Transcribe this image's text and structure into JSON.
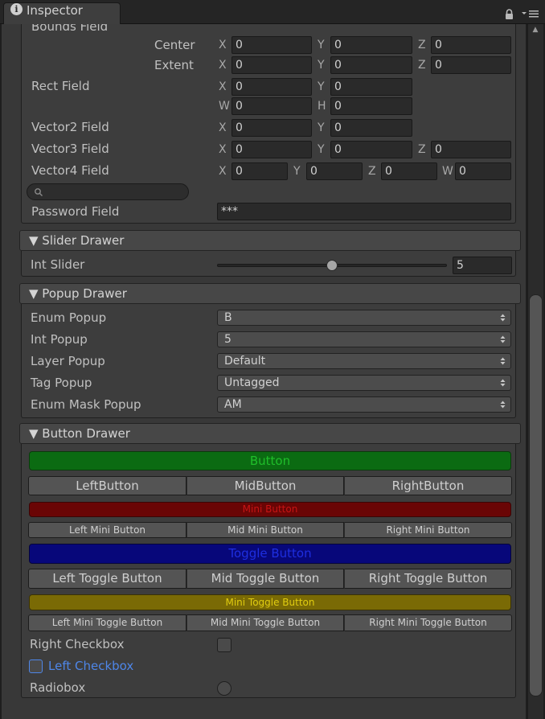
{
  "window": {
    "tab_title": "Inspector",
    "info_icon": "i"
  },
  "bounds": {
    "label": "Bounds Field",
    "center_label": "Center",
    "extent_label": "Extent",
    "center": {
      "x": "0",
      "y": "0",
      "z": "0"
    },
    "extent": {
      "x": "0",
      "y": "0",
      "z": "0"
    }
  },
  "rect": {
    "label": "Rect Field",
    "x": "0",
    "y": "0",
    "w": "0",
    "h": "0"
  },
  "vector2": {
    "label": "Vector2 Field",
    "x": "0",
    "y": "0"
  },
  "vector3": {
    "label": "Vector3 Field",
    "x": "0",
    "y": "0",
    "z": "0"
  },
  "vector4": {
    "label": "Vector4 Field",
    "x": "0",
    "y": "0",
    "z": "0",
    "w": "0"
  },
  "axis": {
    "x": "X",
    "y": "Y",
    "z": "Z",
    "w": "W",
    "h": "H"
  },
  "search": {
    "value": ""
  },
  "password": {
    "label": "Password Field",
    "value": "***"
  },
  "slider_drawer": {
    "header": "▼ Slider Drawer",
    "int_slider_label": "Int Slider",
    "int_slider_value": "5",
    "int_slider_fraction": 0.5
  },
  "popup_drawer": {
    "header": "▼ Popup Drawer",
    "items": [
      {
        "label": "Enum Popup",
        "value": "B"
      },
      {
        "label": "Int Popup",
        "value": "5"
      },
      {
        "label": "Layer Popup",
        "value": "Default"
      },
      {
        "label": "Tag Popup",
        "value": "Untagged"
      },
      {
        "label": "Enum Mask Popup",
        "value": "AM"
      }
    ],
    "arrow": "▲▼"
  },
  "button_drawer": {
    "header": "▼ Button Drawer",
    "button": "Button",
    "left_button": "LeftButton",
    "mid_button": "MidButton",
    "right_button": "RightButton",
    "mini_button": "Mini Button",
    "left_mini_button": "Left Mini Button",
    "mid_mini_button": "Mid Mini Button",
    "right_mini_button": "Right Mini Button",
    "toggle_button": "Toggle Button",
    "left_toggle_button": "Left Toggle Button",
    "mid_toggle_button": "Mid Toggle Button",
    "right_toggle_button": "Right Toggle Button",
    "mini_toggle_button": "Mini Toggle Button",
    "left_mini_toggle_button": "Left Mini Toggle Button",
    "mid_mini_toggle_button": "Mid Mini Toggle Button",
    "right_mini_toggle_button": "Right Mini Toggle Button",
    "right_checkbox": "Right Checkbox",
    "left_checkbox": "Left Checkbox",
    "radiobox": "Radiobox"
  },
  "colors": {
    "button_bg": "#0b6b12",
    "button_text": "#1fbf2a",
    "mini_button_bg": "#6a0505",
    "mini_button_text": "#c81414",
    "toggle_button_bg": "#07077a",
    "toggle_button_text": "#1e2ee0",
    "mini_toggle_bg": "#7a6a05",
    "mini_toggle_text": "#e0cc10",
    "left_checkbox_text": "#4e86e8"
  }
}
